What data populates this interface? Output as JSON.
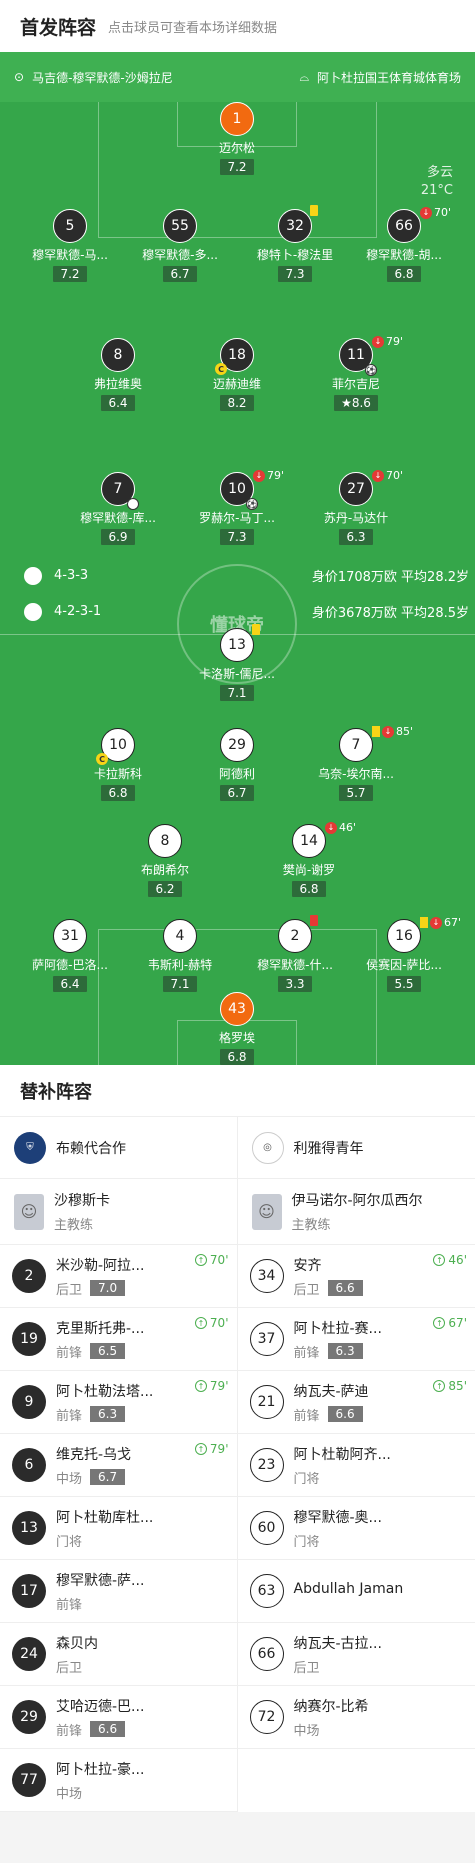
{
  "header": {
    "title": "首发阵容",
    "subtitle": "点击球员可查看本场详细数据"
  },
  "match": {
    "home_coach_line": "马吉德-穆罕默德-沙姆拉尼",
    "stadium": "阿卜杜拉国王体育城体育场",
    "weather": "多云",
    "temperature": "21°C"
  },
  "home_team": {
    "formation": "4-3-3",
    "value_text": "身价1708万欧 平均28.2岁",
    "players": [
      {
        "num": "1",
        "name": "迈尔松",
        "rating": "7.2"
      },
      {
        "num": "5",
        "name": "穆罕默德-马...",
        "rating": "7.2"
      },
      {
        "num": "55",
        "name": "穆罕默德-多...",
        "rating": "6.7"
      },
      {
        "num": "32",
        "name": "穆特卜-穆法里",
        "rating": "7.3"
      },
      {
        "num": "66",
        "name": "穆罕默德-胡...",
        "rating": "6.8",
        "sub": "70'"
      },
      {
        "num": "8",
        "name": "弗拉维奥",
        "rating": "6.4"
      },
      {
        "num": "18",
        "name": "迈赫迪维",
        "rating": "8.2"
      },
      {
        "num": "11",
        "name": "菲尔吉尼",
        "rating": "8.6",
        "sub": "79'"
      },
      {
        "num": "7",
        "name": "穆罕默德-库...",
        "rating": "6.9"
      },
      {
        "num": "10",
        "name": "罗赫尔-马丁...",
        "rating": "7.3",
        "sub": "79'"
      },
      {
        "num": "27",
        "name": "苏丹-马达什",
        "rating": "6.3",
        "sub": "70'"
      }
    ]
  },
  "away_team": {
    "formation": "4-2-3-1",
    "value_text": "身价3678万欧 平均28.5岁",
    "players": [
      {
        "num": "13",
        "name": "卡洛斯-儒尼...",
        "rating": "7.1"
      },
      {
        "num": "10",
        "name": "卡拉斯科",
        "rating": "6.8"
      },
      {
        "num": "29",
        "name": "阿德利",
        "rating": "6.7"
      },
      {
        "num": "7",
        "name": "乌奈-埃尔南...",
        "rating": "5.7",
        "sub": "85'"
      },
      {
        "num": "8",
        "name": "布朗希尔",
        "rating": "6.2"
      },
      {
        "num": "14",
        "name": "樊尚-谢罗",
        "rating": "6.8",
        "sub": "46'"
      },
      {
        "num": "31",
        "name": "萨阿德-巴洛...",
        "rating": "6.4"
      },
      {
        "num": "4",
        "name": "韦斯利-赫特",
        "rating": "7.1"
      },
      {
        "num": "2",
        "name": "穆罕默德-什...",
        "rating": "3.3"
      },
      {
        "num": "16",
        "name": "侯赛因-萨比...",
        "rating": "5.5",
        "sub": "67'"
      },
      {
        "num": "43",
        "name": "格罗埃",
        "rating": "6.8"
      }
    ]
  },
  "watermark": "懂球帝",
  "subs": {
    "title": "替补阵容",
    "home": {
      "team": "布赖代合作",
      "coach": "沙穆斯卡",
      "coach_role": "主教练",
      "list": [
        {
          "num": "2",
          "name": "米沙勒-阿拉...",
          "pos": "后卫",
          "rating": "7.0",
          "in": "70'"
        },
        {
          "num": "19",
          "name": "克里斯托弗-...",
          "pos": "前锋",
          "rating": "6.5",
          "in": "70'"
        },
        {
          "num": "9",
          "name": "阿卜杜勒法塔...",
          "pos": "前锋",
          "rating": "6.3",
          "in": "79'"
        },
        {
          "num": "6",
          "name": "维克托-乌戈",
          "pos": "中场",
          "rating": "6.7",
          "in": "79'"
        },
        {
          "num": "13",
          "name": "阿卜杜勒库杜...",
          "pos": "门将"
        },
        {
          "num": "17",
          "name": "穆罕默德-萨...",
          "pos": "前锋"
        },
        {
          "num": "24",
          "name": "森贝内",
          "pos": "后卫"
        },
        {
          "num": "29",
          "name": "艾哈迈德-巴...",
          "pos": "前锋",
          "rating": "6.6"
        },
        {
          "num": "77",
          "name": "阿卜杜拉-豪...",
          "pos": "中场"
        }
      ]
    },
    "away": {
      "team": "利雅得青年",
      "coach": "伊马诺尔-阿尔瓜西尔",
      "coach_role": "主教练",
      "list": [
        {
          "num": "34",
          "name": "安齐",
          "pos": "后卫",
          "rating": "6.6",
          "in": "46'"
        },
        {
          "num": "37",
          "name": "阿卜杜拉-赛...",
          "pos": "前锋",
          "rating": "6.3",
          "in": "67'"
        },
        {
          "num": "21",
          "name": "纳瓦夫-萨迪",
          "pos": "前锋",
          "rating": "6.6",
          "in": "85'"
        },
        {
          "num": "23",
          "name": "阿卜杜勒阿齐...",
          "pos": "门将"
        },
        {
          "num": "60",
          "name": "穆罕默德-奥...",
          "pos": "门将"
        },
        {
          "num": "63",
          "name": "Abdullah Jaman",
          "pos": ""
        },
        {
          "num": "66",
          "name": "纳瓦夫-古拉...",
          "pos": "后卫"
        },
        {
          "num": "72",
          "name": "纳赛尔-比希",
          "pos": "中场"
        }
      ]
    }
  }
}
